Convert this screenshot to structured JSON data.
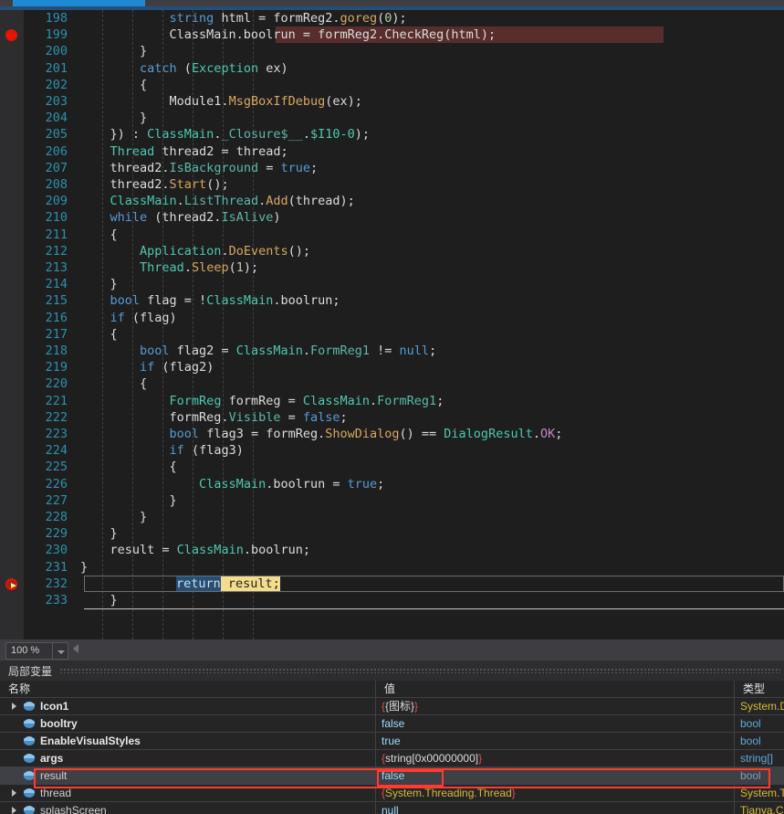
{
  "window": {
    "zoom_level": "100 %"
  },
  "editor": {
    "first_line_number": 198,
    "lines": [
      {
        "n": "198",
        "indent": 0,
        "tokens": [
          {
            "t": "            ",
            "c": "pl"
          },
          {
            "t": "string",
            "c": "kw"
          },
          {
            "t": " html = formReg2.",
            "c": "pl"
          },
          {
            "t": "goreg",
            "c": "meth"
          },
          {
            "t": "(",
            "c": "pl"
          },
          {
            "t": "0",
            "c": "num"
          },
          {
            "t": ");",
            "c": "pl"
          }
        ]
      },
      {
        "n": "199",
        "breakpoint": "solid",
        "highlight": "breakpoint",
        "tokens": [
          {
            "t": "            ClassMain.boolrun = formReg2.CheckReg(html);",
            "c": "pl"
          }
        ]
      },
      {
        "n": "200",
        "tokens": [
          {
            "t": "        }",
            "c": "pl"
          }
        ]
      },
      {
        "n": "201",
        "tokens": [
          {
            "t": "        ",
            "c": "pl"
          },
          {
            "t": "catch",
            "c": "kw"
          },
          {
            "t": " (",
            "c": "pl"
          },
          {
            "t": "Exception",
            "c": "type"
          },
          {
            "t": " ex)",
            "c": "pl"
          }
        ]
      },
      {
        "n": "202",
        "tokens": [
          {
            "t": "        {",
            "c": "pl"
          }
        ]
      },
      {
        "n": "203",
        "tokens": [
          {
            "t": "            Module1.",
            "c": "pl"
          },
          {
            "t": "MsgBoxIfDebug",
            "c": "meth"
          },
          {
            "t": "(ex);",
            "c": "pl"
          }
        ]
      },
      {
        "n": "204",
        "tokens": [
          {
            "t": "        }",
            "c": "pl"
          }
        ]
      },
      {
        "n": "205",
        "tokens": [
          {
            "t": "    }) : ",
            "c": "pl"
          },
          {
            "t": "ClassMain",
            "c": "type"
          },
          {
            "t": ".",
            "c": "pl"
          },
          {
            "t": "_Closure$__",
            "c": "prop"
          },
          {
            "t": ".",
            "c": "pl"
          },
          {
            "t": "$I10-0",
            "c": "type"
          },
          {
            "t": ");",
            "c": "pl"
          }
        ]
      },
      {
        "n": "206",
        "tokens": [
          {
            "t": "    ",
            "c": "pl"
          },
          {
            "t": "Thread",
            "c": "type"
          },
          {
            "t": " thread2 = thread;",
            "c": "pl"
          }
        ]
      },
      {
        "n": "207",
        "tokens": [
          {
            "t": "    thread2.",
            "c": "pl"
          },
          {
            "t": "IsBackground",
            "c": "prop"
          },
          {
            "t": " = ",
            "c": "pl"
          },
          {
            "t": "true",
            "c": "kw"
          },
          {
            "t": ";",
            "c": "pl"
          }
        ]
      },
      {
        "n": "208",
        "tokens": [
          {
            "t": "    thread2.",
            "c": "pl"
          },
          {
            "t": "Start",
            "c": "meth"
          },
          {
            "t": "();",
            "c": "pl"
          }
        ]
      },
      {
        "n": "209",
        "tokens": [
          {
            "t": "    ",
            "c": "pl"
          },
          {
            "t": "ClassMain",
            "c": "type"
          },
          {
            "t": ".",
            "c": "pl"
          },
          {
            "t": "ListThread",
            "c": "prop"
          },
          {
            "t": ".",
            "c": "pl"
          },
          {
            "t": "Add",
            "c": "meth"
          },
          {
            "t": "(thread);",
            "c": "pl"
          }
        ]
      },
      {
        "n": "210",
        "tokens": [
          {
            "t": "    ",
            "c": "pl"
          },
          {
            "t": "while",
            "c": "kw"
          },
          {
            "t": " (thread2.",
            "c": "pl"
          },
          {
            "t": "IsAlive",
            "c": "prop"
          },
          {
            "t": ")",
            "c": "pl"
          }
        ]
      },
      {
        "n": "211",
        "tokens": [
          {
            "t": "    {",
            "c": "pl"
          }
        ]
      },
      {
        "n": "212",
        "tokens": [
          {
            "t": "        ",
            "c": "pl"
          },
          {
            "t": "Application",
            "c": "type"
          },
          {
            "t": ".",
            "c": "pl"
          },
          {
            "t": "DoEvents",
            "c": "meth"
          },
          {
            "t": "();",
            "c": "pl"
          }
        ]
      },
      {
        "n": "213",
        "tokens": [
          {
            "t": "        ",
            "c": "pl"
          },
          {
            "t": "Thread",
            "c": "type"
          },
          {
            "t": ".",
            "c": "pl"
          },
          {
            "t": "Sleep",
            "c": "meth"
          },
          {
            "t": "(",
            "c": "pl"
          },
          {
            "t": "1",
            "c": "num"
          },
          {
            "t": ");",
            "c": "pl"
          }
        ]
      },
      {
        "n": "214",
        "tokens": [
          {
            "t": "    }",
            "c": "pl"
          }
        ]
      },
      {
        "n": "215",
        "tokens": [
          {
            "t": "    ",
            "c": "pl"
          },
          {
            "t": "bool",
            "c": "kw"
          },
          {
            "t": " flag = !",
            "c": "pl"
          },
          {
            "t": "ClassMain",
            "c": "type"
          },
          {
            "t": ".boolrun;",
            "c": "pl"
          }
        ]
      },
      {
        "n": "216",
        "tokens": [
          {
            "t": "    ",
            "c": "pl"
          },
          {
            "t": "if",
            "c": "kw"
          },
          {
            "t": " (flag)",
            "c": "pl"
          }
        ]
      },
      {
        "n": "217",
        "tokens": [
          {
            "t": "    {",
            "c": "pl"
          }
        ]
      },
      {
        "n": "218",
        "tokens": [
          {
            "t": "        ",
            "c": "pl"
          },
          {
            "t": "bool",
            "c": "kw"
          },
          {
            "t": " flag2 = ",
            "c": "pl"
          },
          {
            "t": "ClassMain",
            "c": "type"
          },
          {
            "t": ".",
            "c": "pl"
          },
          {
            "t": "FormReg1",
            "c": "prop"
          },
          {
            "t": " != ",
            "c": "pl"
          },
          {
            "t": "null",
            "c": "kw"
          },
          {
            "t": ";",
            "c": "pl"
          }
        ]
      },
      {
        "n": "219",
        "tokens": [
          {
            "t": "        ",
            "c": "pl"
          },
          {
            "t": "if",
            "c": "kw"
          },
          {
            "t": " (flag2)",
            "c": "pl"
          }
        ]
      },
      {
        "n": "220",
        "tokens": [
          {
            "t": "        {",
            "c": "pl"
          }
        ]
      },
      {
        "n": "221",
        "tokens": [
          {
            "t": "            ",
            "c": "pl"
          },
          {
            "t": "FormReg",
            "c": "type"
          },
          {
            "t": " formReg = ",
            "c": "pl"
          },
          {
            "t": "ClassMain",
            "c": "type"
          },
          {
            "t": ".",
            "c": "pl"
          },
          {
            "t": "FormReg1",
            "c": "prop"
          },
          {
            "t": ";",
            "c": "pl"
          }
        ]
      },
      {
        "n": "222",
        "tokens": [
          {
            "t": "            formReg.",
            "c": "pl"
          },
          {
            "t": "Visible",
            "c": "prop"
          },
          {
            "t": " = ",
            "c": "pl"
          },
          {
            "t": "false",
            "c": "kw"
          },
          {
            "t": ";",
            "c": "pl"
          }
        ]
      },
      {
        "n": "223",
        "tokens": [
          {
            "t": "            ",
            "c": "pl"
          },
          {
            "t": "bool",
            "c": "kw"
          },
          {
            "t": " flag3 = formReg.",
            "c": "pl"
          },
          {
            "t": "ShowDialog",
            "c": "meth"
          },
          {
            "t": "() == ",
            "c": "pl"
          },
          {
            "t": "DialogResult",
            "c": "type"
          },
          {
            "t": ".",
            "c": "pl"
          },
          {
            "t": "OK",
            "c": "en"
          },
          {
            "t": ";",
            "c": "pl"
          }
        ]
      },
      {
        "n": "224",
        "tokens": [
          {
            "t": "            ",
            "c": "pl"
          },
          {
            "t": "if",
            "c": "kw"
          },
          {
            "t": " (flag3)",
            "c": "pl"
          }
        ]
      },
      {
        "n": "225",
        "tokens": [
          {
            "t": "            {",
            "c": "pl"
          }
        ]
      },
      {
        "n": "226",
        "tokens": [
          {
            "t": "                ",
            "c": "pl"
          },
          {
            "t": "ClassMain",
            "c": "type"
          },
          {
            "t": ".boolrun = ",
            "c": "pl"
          },
          {
            "t": "true",
            "c": "kw"
          },
          {
            "t": ";",
            "c": "pl"
          }
        ]
      },
      {
        "n": "227",
        "tokens": [
          {
            "t": "            }",
            "c": "pl"
          }
        ]
      },
      {
        "n": "228",
        "tokens": [
          {
            "t": "        }",
            "c": "pl"
          }
        ]
      },
      {
        "n": "229",
        "tokens": [
          {
            "t": "    }",
            "c": "pl"
          }
        ]
      },
      {
        "n": "230",
        "tokens": [
          {
            "t": "    result = ",
            "c": "pl"
          },
          {
            "t": "ClassMain",
            "c": "type"
          },
          {
            "t": ".boolrun;",
            "c": "pl"
          }
        ]
      },
      {
        "n": "231",
        "tokens": [
          {
            "t": "}",
            "c": "pl"
          }
        ]
      },
      {
        "n": "232",
        "breakpoint": "current",
        "current": true,
        "tokens": [
          {
            "t": "return",
            "c": "sel-hl"
          },
          {
            "t": " result;",
            "c": "cur-stmt"
          }
        ]
      },
      {
        "n": "233",
        "tokens": [
          {
            "t": "    }",
            "c": "pl"
          }
        ]
      }
    ]
  },
  "locals": {
    "title": "局部变量",
    "columns": [
      "名称",
      "值",
      "类型"
    ],
    "rows": [
      {
        "expandable": true,
        "name": "Icon1",
        "bold": true,
        "value": "{{图标}}",
        "value_class": "v-brace",
        "type": "System.D",
        "type_class": "t-sys"
      },
      {
        "expandable": false,
        "name": "booltry",
        "bold": true,
        "value": "false",
        "value_class": "v-bool",
        "type": "bool",
        "type_class": "t-prim"
      },
      {
        "expandable": false,
        "name": "EnableVisualStyles",
        "bold": true,
        "value": "true",
        "value_class": "v-bool",
        "type": "bool",
        "type_class": "t-prim"
      },
      {
        "expandable": false,
        "name": "args",
        "bold": true,
        "value": "{string[0x00000000]}",
        "value_class": "v-brace",
        "type": "string[]",
        "type_class": "t-prim"
      },
      {
        "expandable": false,
        "name": "result",
        "bold": false,
        "selected": true,
        "highlighted": true,
        "value": "false",
        "value_class": "v-bool",
        "type": "bool",
        "type_class": "t-dim"
      },
      {
        "expandable": true,
        "name": "thread",
        "bold": false,
        "value": "{System.Threading.Thread}",
        "value_class": "v-brace",
        "type": "System.T",
        "type_class": "t-sys"
      },
      {
        "expandable": true,
        "name": "splashScreen",
        "bold": false,
        "value": "null",
        "value_class": "v-null",
        "type": "Tianya.C",
        "type_class": "t-sys"
      }
    ]
  }
}
